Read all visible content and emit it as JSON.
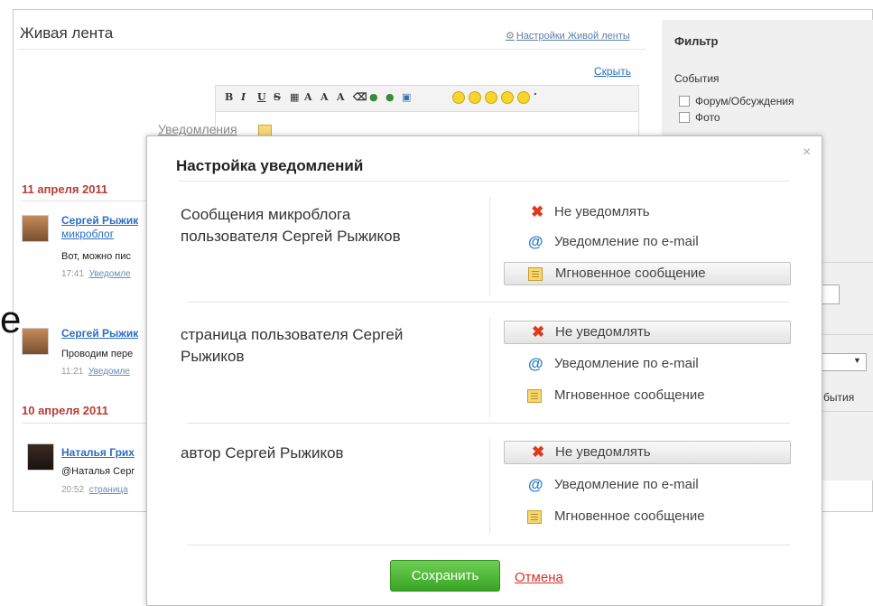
{
  "page": {
    "title": "Живая лента",
    "settings_link": "Настройки Живой ленты",
    "hide_link": "Скрыть",
    "notifications_tab": "Уведомления",
    "big_glyph": "е"
  },
  "filter": {
    "title": "Фильтр",
    "events_label": "События",
    "checkbox_1": "Форум/Обсуждения",
    "checkbox_2": "Фото",
    "events_text": "бытия"
  },
  "feed": {
    "dates": [
      "11 апреля 2011",
      "10 апреля 2011"
    ],
    "posts": [
      {
        "author": "Сергей Рыжик",
        "sub": "микроблог",
        "text": "Вот, можно пис",
        "time": "17:41",
        "meta_link": "Уведомле"
      },
      {
        "author": "Сергей Рыжик",
        "text": "Проводим пере",
        "time": "11:21",
        "meta_link": "Уведомле"
      },
      {
        "author": "Наталья Грих",
        "text": "@Наталья Серг",
        "time": "20:52",
        "meta_link": "страница"
      }
    ]
  },
  "modal": {
    "title": "Настройка уведомлений",
    "groups": [
      {
        "text": [
          "Сообщения микроблога",
          "пользователя Сергей Рыжиков"
        ],
        "options": [
          "Не уведомлять",
          "Уведомление по e-mail",
          "Мгновенное сообщение"
        ],
        "selected": 2
      },
      {
        "text": [
          "страница пользователя Сергей",
          "Рыжиков"
        ],
        "options": [
          "Не уведомлять",
          "Уведомление по e-mail",
          "Мгновенное сообщение"
        ],
        "selected": 0
      },
      {
        "text": [
          "автор Сергей Рыжиков"
        ],
        "options": [
          "Не уведомлять",
          "Уведомление по e-mail",
          "Мгновенное сообщение"
        ],
        "selected": 0
      }
    ],
    "save_label": "Сохранить",
    "cancel_label": "Отмена",
    "close_symbol": "×"
  },
  "icons": {
    "none": "close-x-icon",
    "email": "at-sign-icon",
    "instant": "instant-message-icon"
  },
  "colors": {
    "accent_blue": "#2a6ec3",
    "date_red": "#b73c37",
    "save_green": "#38a523",
    "cancel_red": "#d4322b",
    "x_red": "#e03a1e"
  }
}
